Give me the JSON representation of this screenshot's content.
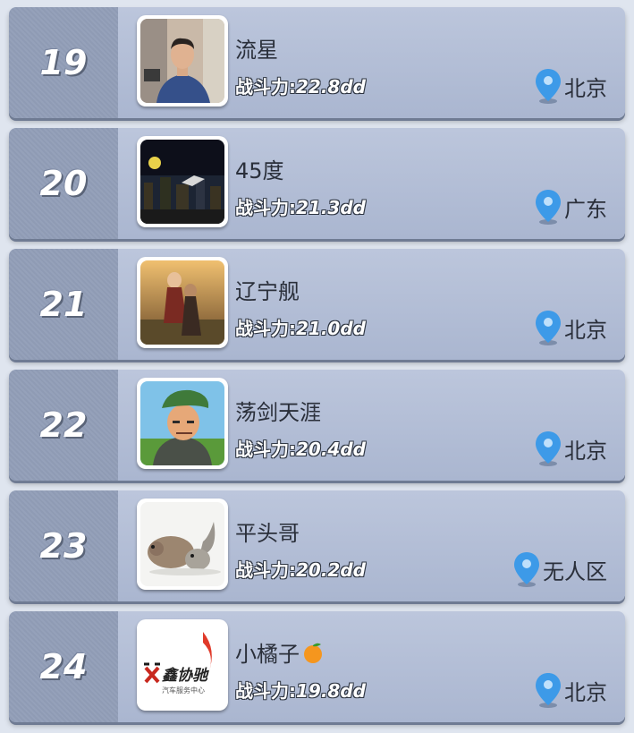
{
  "leaderboard": {
    "power_label": "战斗力",
    "colon": ":",
    "rows": [
      {
        "rank": "19",
        "name": "流星",
        "power": "22.8dd",
        "location": "北京",
        "avatar_icon": "man-photo-avatar"
      },
      {
        "rank": "20",
        "name": "45度",
        "power": "21.3dd",
        "location": "广东",
        "avatar_icon": "night-city-avatar"
      },
      {
        "rank": "21",
        "name": "辽宁舰",
        "power": "21.0dd",
        "location": "北京",
        "avatar_icon": "couple-sunset-avatar"
      },
      {
        "rank": "22",
        "name": "荡剑天涯",
        "power": "20.4dd",
        "location": "北京",
        "avatar_icon": "soldier-cartoon-avatar"
      },
      {
        "rank": "23",
        "name": "平头哥",
        "power": "20.2dd",
        "location": "无人区",
        "avatar_icon": "guinea-pig-squirrel-avatar"
      },
      {
        "rank": "24",
        "name": "小橘子",
        "name_emoji": "orange-emoji",
        "power": "19.8dd",
        "location": "北京",
        "avatar_icon": "logo-avatar",
        "avatar_text": "鑫协驰",
        "avatar_subtext": "汽车服务中心"
      }
    ]
  },
  "colors": {
    "accent_pin": "#3d9ae8",
    "row_bg": "#b3bfd6"
  }
}
